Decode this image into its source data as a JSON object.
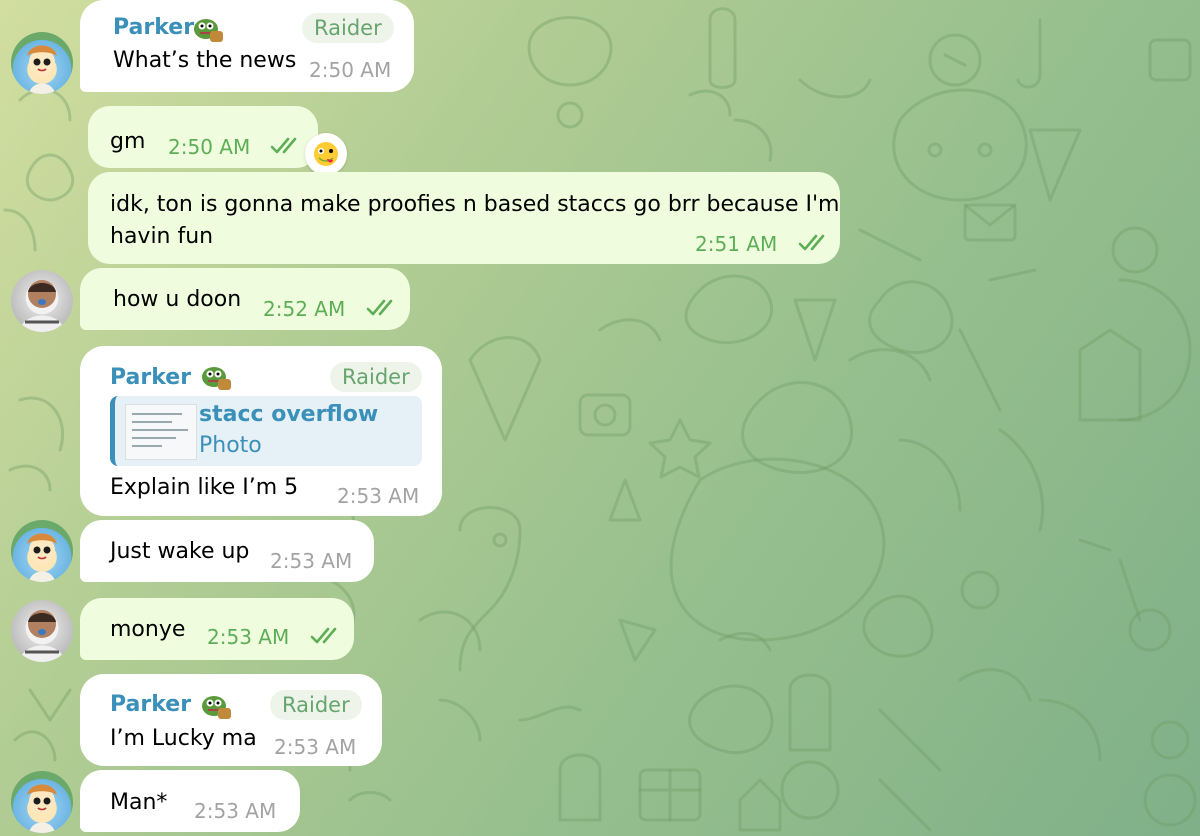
{
  "chat": {
    "messages": [
      {
        "sender": "Parker",
        "badge": "Raider",
        "text": "What’s the news",
        "time": "2:50 AM"
      },
      {
        "text": "gm",
        "time": "2:50 AM",
        "reaction": "zany-face-emoji"
      },
      {
        "text_line1": "idk, ton is gonna make proofies n based staccs go brr because I'm",
        "text_line2": "havin fun",
        "time": "2:51 AM"
      },
      {
        "text": "how u doon",
        "time": "2:52 AM"
      },
      {
        "sender": "Parker",
        "badge": "Raider",
        "reply": {
          "title": "stacc overflow",
          "subtitle": "Photo"
        },
        "text": "Explain like I’m 5",
        "time": "2:53 AM"
      },
      {
        "text": "Just wake up",
        "time": "2:53 AM"
      },
      {
        "text": "monye",
        "time": "2:53 AM"
      },
      {
        "sender": "Parker",
        "badge": "Raider",
        "text": "I’m Lucky ma",
        "time": "2:53 AM"
      },
      {
        "text": "Man*",
        "time": "2:53 AM"
      }
    ]
  },
  "colors": {
    "sender": "#3a90b8",
    "badge": "#67a56e",
    "outgoing_bubble": "#effdde",
    "outgoing_meta": "#5eae58",
    "time": "#a3a3a3"
  },
  "icons": [
    "double-check-icon",
    "pepe-emoji-icon",
    "zany-face-emoji"
  ]
}
